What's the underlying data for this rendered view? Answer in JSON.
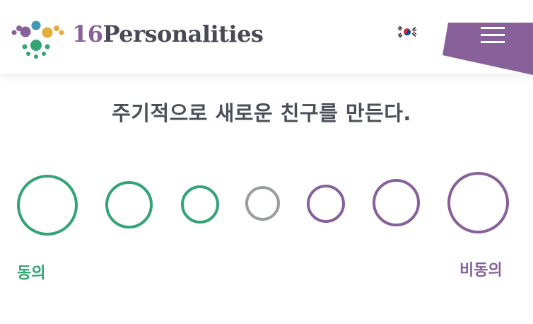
{
  "header": {
    "logo_number": "16",
    "logo_word": "Personalities",
    "language_flag_icon": "south-korea-flag-icon",
    "menu_icon": "hamburger-menu-icon"
  },
  "question": {
    "text": "주기적으로 새로운 친구를 만든다."
  },
  "scale": {
    "option_count": 7,
    "agree_label": "동의",
    "disagree_label": "비동의"
  },
  "colors": {
    "agree": "#33a474",
    "neutral": "#9b9da4",
    "disagree": "#88619a",
    "text": "#4a4f5a",
    "logo_text": "#4a4a57"
  }
}
